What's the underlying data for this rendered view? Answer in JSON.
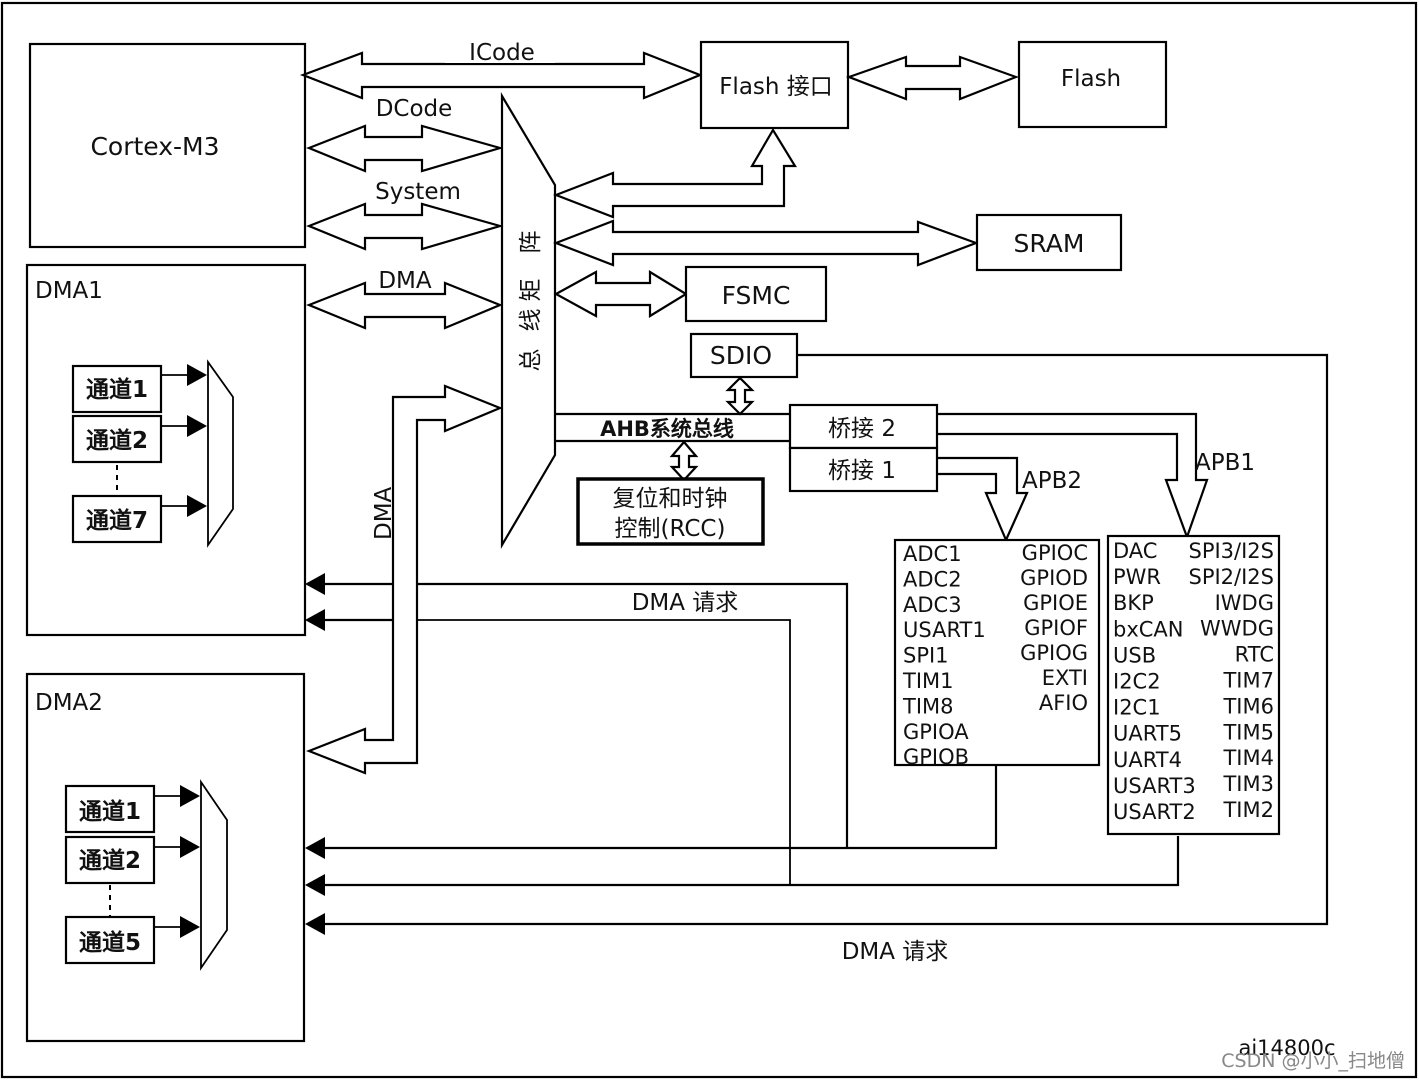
{
  "blocks": {
    "cortex": "Cortex-M3",
    "flash_interface": "Flash 接口",
    "flash": "Flash",
    "sram": "SRAM",
    "fsmc": "FSMC",
    "sdio": "SDIO",
    "bus_matrix": [
      "总",
      "线",
      "矩",
      "阵"
    ],
    "bridge2": "桥接 2",
    "bridge1": "桥接 1",
    "rcc_line1": "复位和时钟",
    "rcc_line2": "控制(RCC)",
    "dma1": "DMA1",
    "dma2": "DMA2"
  },
  "buses": {
    "icode": "ICode",
    "dcode": "DCode",
    "system": "System",
    "dma": "DMA",
    "dma_vertical": "DMA",
    "ahb": "AHB系统总线",
    "apb1": "APB1",
    "apb2": "APB2",
    "dma_request_1": "DMA 请求",
    "dma_request_2": "DMA 请求"
  },
  "dma1_channels": [
    "通道1",
    "通道2",
    "通道7"
  ],
  "dma2_channels": [
    "通道1",
    "通道2",
    "通道5"
  ],
  "apb2_peripherals": {
    "left": [
      "ADC1",
      "ADC2",
      "ADC3",
      "USART1",
      "SPI1",
      "TIM1",
      "TIM8",
      "GPIOA",
      "GPIOB"
    ],
    "right": [
      "GPIOC",
      "GPIOD",
      "GPIOE",
      "GPIOF",
      "GPIOG",
      "EXTI",
      "AFIO"
    ]
  },
  "apb1_peripherals": {
    "left": [
      "DAC",
      "PWR",
      "BKP",
      "bxCAN",
      "USB",
      "I2C2",
      "I2C1",
      "UART5",
      "UART4",
      "USART3",
      "USART2"
    ],
    "right": [
      "SPI3/I2S",
      "SPI2/I2S",
      "IWDG",
      "WWDG",
      "RTC",
      "TIM7",
      "TIM6",
      "TIM5",
      "TIM4",
      "TIM3",
      "TIM2"
    ]
  },
  "figure_id": "ai14800c",
  "watermark": "CSDN @小小_扫地僧"
}
